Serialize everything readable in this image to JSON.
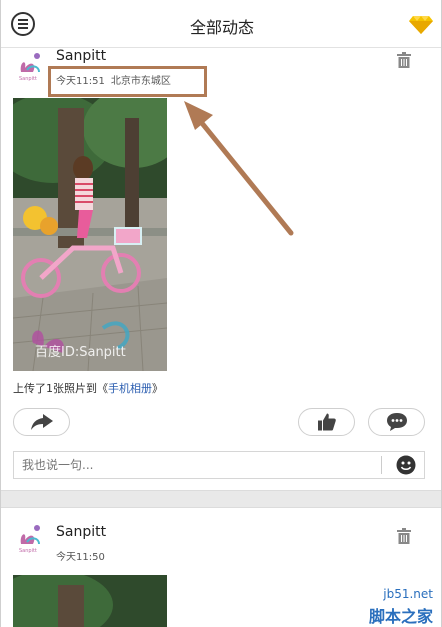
{
  "header": {
    "title": "全部动态",
    "menu_icon": "menu-icon",
    "vip_icon": "diamond-icon",
    "accent_color": "#f5c400"
  },
  "post1": {
    "username": "Sanpitt",
    "time": "今天11:51",
    "location": "北京市东城区",
    "caption_prefix": "上传了1张照片到《",
    "caption_link": "手机相册",
    "caption_suffix": "》",
    "photo_watermark": "百度ID:Sanpitt",
    "comment_placeholder": "我也说一句...",
    "link_color": "#2a5db0"
  },
  "post2": {
    "username": "Sanpitt",
    "time": "今天11:50"
  },
  "watermark": {
    "site": "jb51.net",
    "name": "脚本之家"
  },
  "annotation": {
    "box_color": "#b07a55"
  }
}
